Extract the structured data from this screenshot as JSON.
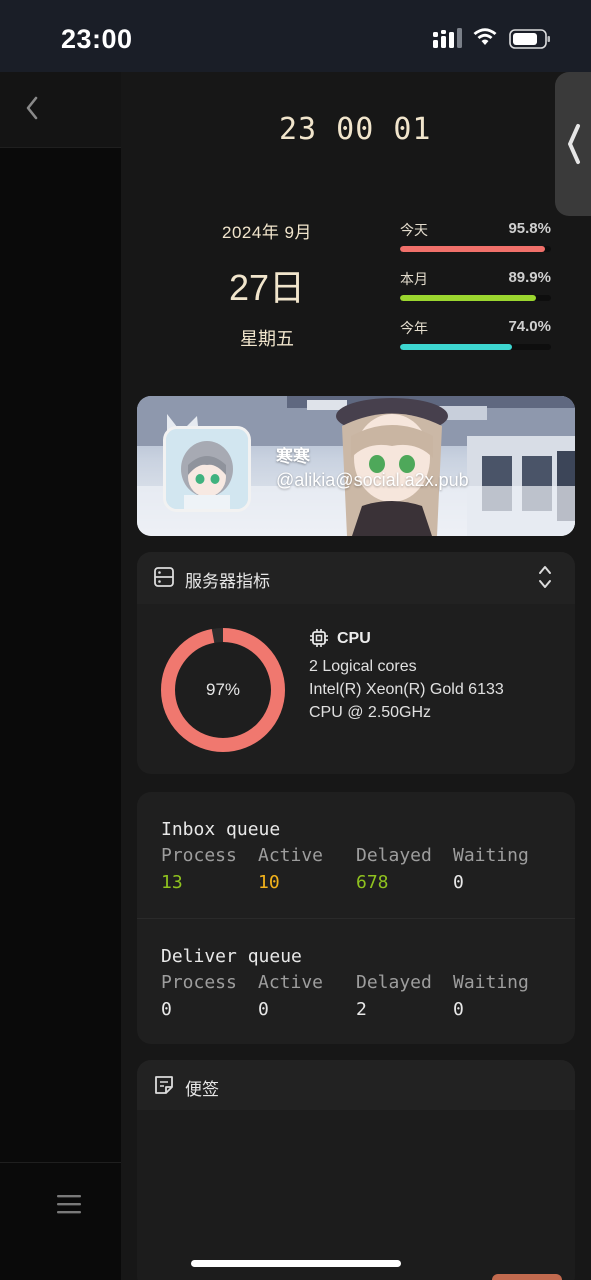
{
  "status_bar": {
    "time": "23:00"
  },
  "clock": {
    "display": "23 00 01"
  },
  "date": {
    "year_month": "2024年 9月",
    "day": "27日",
    "weekday": "星期五"
  },
  "progress": [
    {
      "label": "今天",
      "value_text": "95.8%",
      "value": 0.958,
      "color": "#f0706a"
    },
    {
      "label": "本月",
      "value_text": "89.9%",
      "value": 0.899,
      "color": "#9bd62f"
    },
    {
      "label": "今年",
      "value_text": "74.0%",
      "value": 0.74,
      "color": "#3dd6d0"
    }
  ],
  "profile": {
    "name": "寒寒",
    "handle": "@alikia@social.a2x.pub"
  },
  "server": {
    "title": "服务器指标",
    "cpu": {
      "title": "CPU",
      "percent": 97,
      "percent_text": "97%",
      "ring_color": "#f0786f",
      "cores": "2 Logical cores",
      "model_line1": "Intel(R) Xeon(R) Gold 6133",
      "model_line2": "CPU @ 2.50GHz"
    }
  },
  "queues": [
    {
      "title": "Inbox queue",
      "columns": [
        {
          "label": "Process",
          "value": "13",
          "color": "#8fc21f"
        },
        {
          "label": "Active",
          "value": "10",
          "color": "#f2b21b"
        },
        {
          "label": "Delayed",
          "value": "678",
          "color": "#8fc21f"
        },
        {
          "label": "Waiting",
          "value": "0",
          "color": "#e8e8e8"
        }
      ]
    },
    {
      "title": "Deliver queue",
      "columns": [
        {
          "label": "Process",
          "value": "0",
          "color": "#e8e8e8"
        },
        {
          "label": "Active",
          "value": "0",
          "color": "#e8e8e8"
        },
        {
          "label": "Delayed",
          "value": "2",
          "color": "#e8e8e8"
        },
        {
          "label": "Waiting",
          "value": "0",
          "color": "#e8e8e8"
        }
      ]
    }
  ],
  "notes": {
    "title": "便签"
  },
  "icons": {
    "back": "back-chevron-icon",
    "menu": "hamburger-menu-icon",
    "server": "server-icon",
    "toggle": "expand-collapse-icon",
    "cpu": "cpu-chip-icon",
    "notes": "note-icon",
    "edge": "chevron-left-icon"
  }
}
